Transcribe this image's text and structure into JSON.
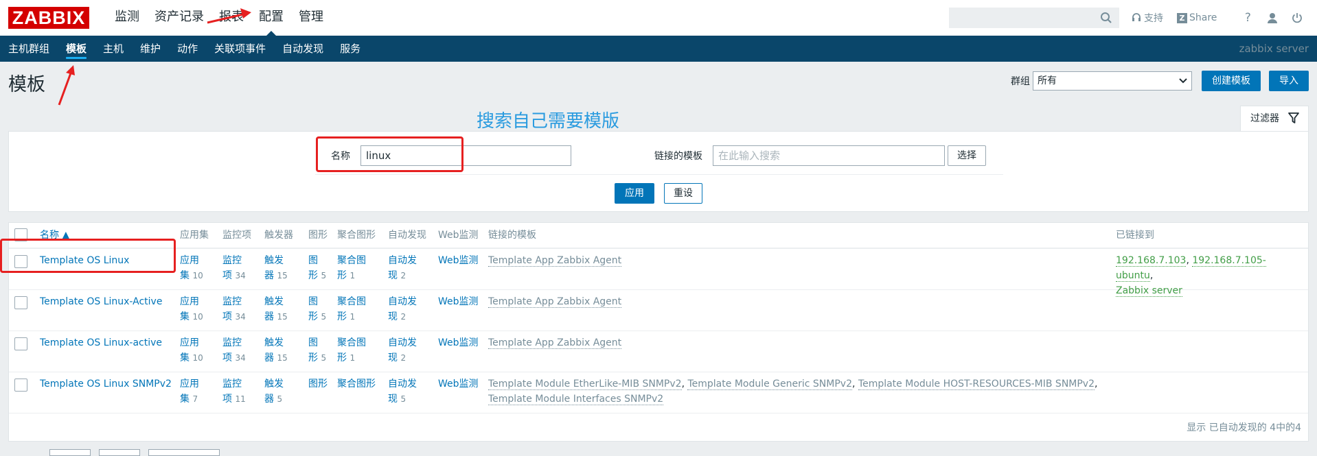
{
  "header": {
    "logo": "ZABBIX",
    "nav": [
      "监测",
      "资产记录",
      "报表",
      "配置",
      "管理"
    ],
    "active_nav": "配置",
    "search_value": "",
    "links": {
      "support": "支持",
      "share": "Share",
      "help": "?"
    }
  },
  "subnav": {
    "items": [
      "主机群组",
      "模板",
      "主机",
      "维护",
      "动作",
      "关联项事件",
      "自动发现",
      "服务"
    ],
    "active": "模板",
    "server": "zabbix server"
  },
  "page": {
    "title": "模板",
    "group_label": "群组",
    "group_value": "所有",
    "create_button": "创建模板",
    "import_button": "导入"
  },
  "filter": {
    "tab_label": "过滤器",
    "annotation": "搜索自己需要模版",
    "name_label": "名称",
    "name_value": "linux",
    "linked_label": "链接的模板",
    "linked_placeholder": "在此输入搜索",
    "select_button": "选择",
    "apply_button": "应用",
    "reset_button": "重设"
  },
  "table": {
    "columns": [
      "名称 ▲",
      "应用集",
      "监控项",
      "触发器",
      "图形",
      "聚合图形",
      "自动发现",
      "Web监测",
      "链接的模板",
      "已链接到"
    ],
    "rows": [
      {
        "name": "Template OS Linux",
        "apps": [
          "应用",
          "集",
          "10"
        ],
        "items": [
          "监控",
          "项",
          "34"
        ],
        "triggers": [
          "触发",
          "器",
          "15"
        ],
        "graphs": [
          "图",
          "形",
          "5"
        ],
        "screens": [
          "聚合图",
          "形",
          "1"
        ],
        "discovery": [
          "自动发",
          "现",
          "2"
        ],
        "web": "Web监测",
        "linked_templates": "Template App Zabbix Agent",
        "linked_to": [
          "192.168.7.103",
          "192.168.7.105-ubuntu",
          "Zabbix server"
        ]
      },
      {
        "name": "Template OS Linux-Active",
        "apps": [
          "应用",
          "集",
          "10"
        ],
        "items": [
          "监控",
          "项",
          "34"
        ],
        "triggers": [
          "触发",
          "器",
          "15"
        ],
        "graphs": [
          "图",
          "形",
          "5"
        ],
        "screens": [
          "聚合图",
          "形",
          "1"
        ],
        "discovery": [
          "自动发",
          "现",
          "2"
        ],
        "web": "Web监测",
        "linked_templates": "Template App Zabbix Agent"
      },
      {
        "name": "Template OS Linux-active",
        "apps": [
          "应用",
          "集",
          "10"
        ],
        "items": [
          "监控",
          "项",
          "34"
        ],
        "triggers": [
          "触发",
          "器",
          "15"
        ],
        "graphs": [
          "图",
          "形",
          "5"
        ],
        "screens": [
          "聚合图",
          "形",
          "1"
        ],
        "discovery": [
          "自动发",
          "现",
          "2"
        ],
        "web": "Web监测",
        "linked_templates": "Template App Zabbix Agent"
      },
      {
        "name": "Template OS Linux SNMPv2",
        "apps": [
          "应用",
          "集",
          "7"
        ],
        "items": [
          "监控",
          "项",
          "11"
        ],
        "triggers": [
          "触发",
          "器",
          "5"
        ],
        "graphs": [
          "图形"
        ],
        "screens": [
          "聚合图形"
        ],
        "discovery": [
          "自动发",
          "现",
          "5"
        ],
        "web": "Web监测",
        "linked_templates_list": [
          "Template Module EtherLike-MIB SNMPv2",
          "Template Module Generic SNMPv2",
          "Template Module HOST-RESOURCES-MIB SNMPv2",
          "Template Module Interfaces SNMPv2"
        ]
      }
    ],
    "footer": "显示 已自动发现的 4中的4"
  },
  "colors": {
    "brand": "#d40000",
    "subnav": "#0a466a",
    "primary": "#0275b8",
    "annotation": "#e62020"
  }
}
